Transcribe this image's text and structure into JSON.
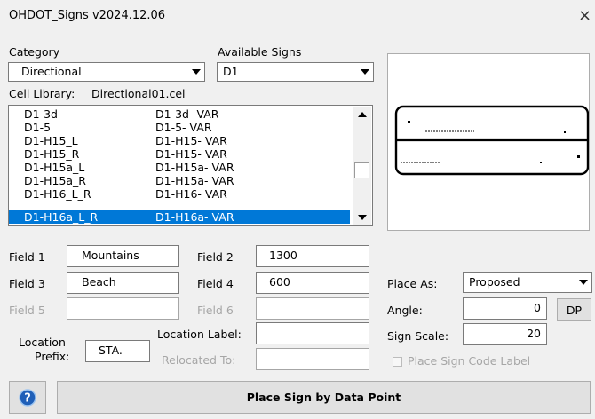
{
  "window": {
    "title": "OHDOT_Signs v2024.12.06",
    "close_glyph": "×"
  },
  "category": {
    "label": "Category",
    "value": "Directional"
  },
  "available_signs": {
    "label": "Available Signs",
    "value": "D1"
  },
  "cell_library": {
    "label": "Cell Library:",
    "value": "Directional01.cel"
  },
  "sign_list": [
    {
      "name": "D1-3d",
      "desc": "D1-3d- VAR"
    },
    {
      "name": "D1-5",
      "desc": "D1-5- VAR"
    },
    {
      "name": "D1-H15_L",
      "desc": "D1-H15- VAR"
    },
    {
      "name": "D1-H15_R",
      "desc": "D1-H15- VAR"
    },
    {
      "name": "D1-H15a_L",
      "desc": "D1-H15a- VAR"
    },
    {
      "name": "D1-H15a_R",
      "desc": "D1-H15a- VAR"
    },
    {
      "name": "D1-H16_L_R",
      "desc": "D1-H16- VAR"
    },
    {
      "name": "D1-H16a_L_R",
      "desc": "D1-H16a- VAR"
    }
  ],
  "selected_sign_index": 7,
  "fields": {
    "field1": {
      "label": "Field 1",
      "value": "Mountains"
    },
    "field2": {
      "label": "Field 2",
      "value": "1300"
    },
    "field3": {
      "label": "Field 3",
      "value": "Beach"
    },
    "field4": {
      "label": "Field 4",
      "value": "600"
    },
    "field5": {
      "label": "Field 5",
      "value": ""
    },
    "field6": {
      "label": "Field 6",
      "value": ""
    }
  },
  "location_prefix": {
    "label_line1": "Location",
    "label_line2": "Prefix:",
    "value": "STA."
  },
  "location_label": {
    "label": "Location Label:",
    "value": ""
  },
  "relocated_to": {
    "label": "Relocated To:",
    "value": ""
  },
  "place_as": {
    "label": "Place As:",
    "value": "Proposed"
  },
  "angle": {
    "label": "Angle:",
    "value": "0"
  },
  "dp_button": {
    "label": "DP"
  },
  "sign_scale": {
    "label": "Sign Scale:",
    "value": "20"
  },
  "place_code_label": {
    "label": "Place Sign Code Label",
    "checked": false
  },
  "place_button": {
    "label": "Place Sign by Data Point"
  },
  "help_icon": "help-icon",
  "colors": {
    "selection": "#0078d7",
    "window_bg": "#f0f0f0",
    "help_blue": "#1f5fb8"
  }
}
